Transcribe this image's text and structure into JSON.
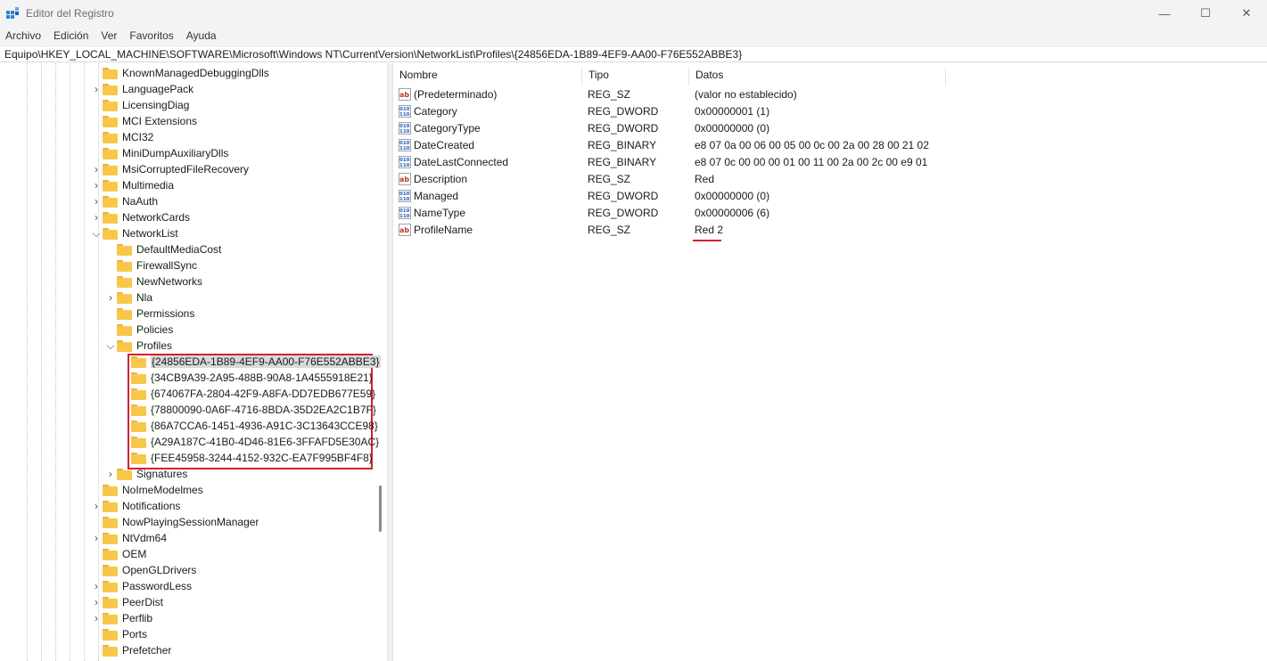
{
  "window": {
    "title": "Editor del Registro"
  },
  "window_controls": {
    "minimize": "—",
    "maximize": "☐",
    "close": "✕"
  },
  "menu": [
    "Archivo",
    "Edición",
    "Ver",
    "Favoritos",
    "Ayuda"
  ],
  "address": "Equipo\\HKEY_LOCAL_MACHINE\\SOFTWARE\\Microsoft\\Windows NT\\CurrentVersion\\NetworkList\\Profiles\\{24856EDA-1B89-4EF9-AA00-F76E552ABBE3}",
  "tree": [
    {
      "label": "KnownManagedDebuggingDlls",
      "level": 0,
      "expander": ""
    },
    {
      "label": "LanguagePack",
      "level": 0,
      "expander": ">"
    },
    {
      "label": "LicensingDiag",
      "level": 0,
      "expander": ""
    },
    {
      "label": "MCI Extensions",
      "level": 0,
      "expander": ""
    },
    {
      "label": "MCI32",
      "level": 0,
      "expander": ""
    },
    {
      "label": "MiniDumpAuxiliaryDlls",
      "level": 0,
      "expander": ""
    },
    {
      "label": "MsiCorruptedFileRecovery",
      "level": 0,
      "expander": ">"
    },
    {
      "label": "Multimedia",
      "level": 0,
      "expander": ">"
    },
    {
      "label": "NaAuth",
      "level": 0,
      "expander": ">"
    },
    {
      "label": "NetworkCards",
      "level": 0,
      "expander": ">"
    },
    {
      "label": "NetworkList",
      "level": 0,
      "expander": "v"
    },
    {
      "label": "DefaultMediaCost",
      "level": 1,
      "expander": ""
    },
    {
      "label": "FirewallSync",
      "level": 1,
      "expander": ""
    },
    {
      "label": "NewNetworks",
      "level": 1,
      "expander": ""
    },
    {
      "label": "Nla",
      "level": 1,
      "expander": ">"
    },
    {
      "label": "Permissions",
      "level": 1,
      "expander": ""
    },
    {
      "label": "Policies",
      "level": 1,
      "expander": ""
    },
    {
      "label": "Profiles",
      "level": 1,
      "expander": "v"
    },
    {
      "label": "{24856EDA-1B89-4EF9-AA00-F76E552ABBE3}",
      "level": 2,
      "expander": "",
      "selected": true
    },
    {
      "label": "{34CB9A39-2A95-488B-90A8-1A4555918E21}",
      "level": 2,
      "expander": ""
    },
    {
      "label": "{674067FA-2804-42F9-A8FA-DD7EDB677E59}",
      "level": 2,
      "expander": ""
    },
    {
      "label": "{78800090-0A6F-4716-8BDA-35D2EA2C1B7F}",
      "level": 2,
      "expander": ""
    },
    {
      "label": "{86A7CCA6-1451-4936-A91C-3C13643CCE98}",
      "level": 2,
      "expander": ""
    },
    {
      "label": "{A29A187C-41B0-4D46-81E6-3FFAFD5E30AC}",
      "level": 2,
      "expander": ""
    },
    {
      "label": "{FEE45958-3244-4152-932C-EA7F995BF4F8}",
      "level": 2,
      "expander": ""
    },
    {
      "label": "Signatures",
      "level": 1,
      "expander": ">"
    },
    {
      "label": "NoImeModelmes",
      "level": 0,
      "expander": ""
    },
    {
      "label": "Notifications",
      "level": 0,
      "expander": ">"
    },
    {
      "label": "NowPlayingSessionManager",
      "level": 0,
      "expander": ""
    },
    {
      "label": "NtVdm64",
      "level": 0,
      "expander": ">"
    },
    {
      "label": "OEM",
      "level": 0,
      "expander": ""
    },
    {
      "label": "OpenGLDrivers",
      "level": 0,
      "expander": ""
    },
    {
      "label": "PasswordLess",
      "level": 0,
      "expander": ">"
    },
    {
      "label": "PeerDist",
      "level": 0,
      "expander": ">"
    },
    {
      "label": "Perflib",
      "level": 0,
      "expander": ">"
    },
    {
      "label": "Ports",
      "level": 0,
      "expander": ""
    },
    {
      "label": "Prefetcher",
      "level": 0,
      "expander": ""
    }
  ],
  "columns": {
    "name": "Nombre",
    "type": "Tipo",
    "data": "Datos"
  },
  "values": [
    {
      "icon": "string-value-icon",
      "name": "(Predeterminado)",
      "type": "REG_SZ",
      "data": "(valor no establecido)"
    },
    {
      "icon": "binary-value-icon",
      "name": "Category",
      "type": "REG_DWORD",
      "data": "0x00000001 (1)"
    },
    {
      "icon": "binary-value-icon",
      "name": "CategoryType",
      "type": "REG_DWORD",
      "data": "0x00000000 (0)"
    },
    {
      "icon": "binary-value-icon",
      "name": "DateCreated",
      "type": "REG_BINARY",
      "data": "e8 07 0a 00 06 00 05 00 0c 00 2a 00 28 00 21 02"
    },
    {
      "icon": "binary-value-icon",
      "name": "DateLastConnected",
      "type": "REG_BINARY",
      "data": "e8 07 0c 00 00 00 01 00 11 00 2a 00 2c 00 e9 01"
    },
    {
      "icon": "string-value-icon",
      "name": "Description",
      "type": "REG_SZ",
      "data": "Red"
    },
    {
      "icon": "binary-value-icon",
      "name": "Managed",
      "type": "REG_DWORD",
      "data": "0x00000000 (0)"
    },
    {
      "icon": "binary-value-icon",
      "name": "NameType",
      "type": "REG_DWORD",
      "data": "0x00000006 (6)"
    },
    {
      "icon": "string-value-icon",
      "name": "ProfileName",
      "type": "REG_SZ",
      "data": "Red 2",
      "underlined": true
    }
  ],
  "colors": {
    "folder": "#f8c74a",
    "highlight": "#d6202b",
    "selection": "#d9d9d9"
  }
}
